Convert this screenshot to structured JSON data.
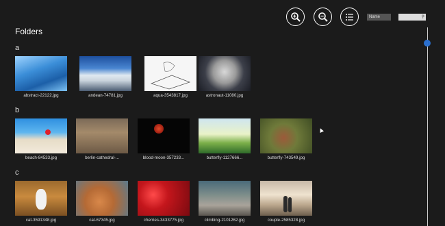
{
  "page": {
    "title": "Folders"
  },
  "toolbar": {
    "sort_label": "Name",
    "search_placeholder": ""
  },
  "groups": [
    {
      "letter": "a",
      "items": [
        {
          "caption": "abstract-22122.jpg"
        },
        {
          "caption": "andean-74781.jpg"
        },
        {
          "caption": "aqua-3543817.jpg"
        },
        {
          "caption": "astronaut-11080.jpg"
        }
      ]
    },
    {
      "letter": "b",
      "items": [
        {
          "caption": "beach-84533.jpg"
        },
        {
          "caption": "berlin-cathedral-..."
        },
        {
          "caption": "blood-moon-357233..."
        },
        {
          "caption": "butterfly-1127666..."
        },
        {
          "caption": "butterfly-743549.jpg"
        }
      ]
    },
    {
      "letter": "c",
      "items": [
        {
          "caption": "cat-3591348.jpg"
        },
        {
          "caption": "cat-67345.jpg"
        },
        {
          "caption": "cherries-3433775.jpg"
        },
        {
          "caption": "climbing-2101262.jpg"
        },
        {
          "caption": "couple-2585328.jpg"
        }
      ]
    }
  ]
}
